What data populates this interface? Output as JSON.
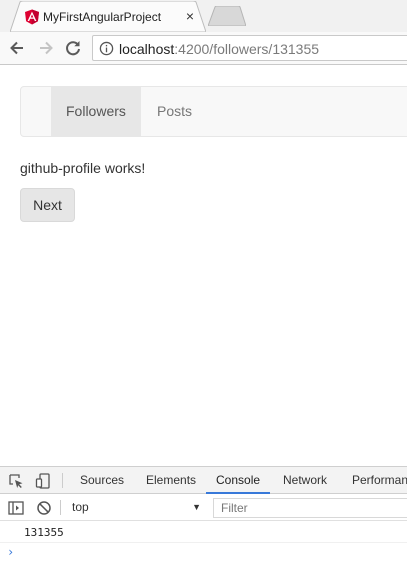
{
  "browser": {
    "tab_title": "MyFirstAngularProject",
    "tab_close": "×",
    "url_host": "localhost",
    "url_rest": ":4200/followers/131355"
  },
  "navbar": {
    "items": [
      {
        "label": "Followers",
        "active": true
      },
      {
        "label": "Posts",
        "active": false
      }
    ]
  },
  "main": {
    "profile_text": "github-profile works!",
    "next_label": "Next"
  },
  "devtools": {
    "tabs": [
      "Sources",
      "Elements",
      "Console",
      "Network",
      "Performan"
    ],
    "active_tab": "Console",
    "context": "top",
    "filter_placeholder": "Filter",
    "log_lines": [
      "131355"
    ],
    "prompt": "›"
  },
  "colors": {
    "angular_red": "#dd0031",
    "devtools_accent": "#3879d9"
  }
}
